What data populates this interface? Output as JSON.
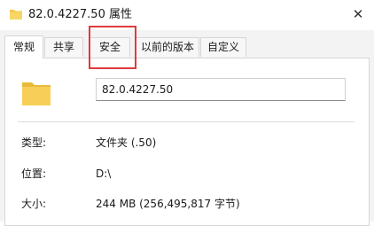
{
  "window": {
    "title": "82.0.4227.50 属性",
    "icon": "folder-icon",
    "close_glyph": "✕"
  },
  "tabs": [
    {
      "label": "常规",
      "active": true
    },
    {
      "label": "共享",
      "active": false
    },
    {
      "label": "安全",
      "active": false,
      "highlighted": true
    },
    {
      "label": "以前的版本",
      "active": false
    },
    {
      "label": "自定义",
      "active": false
    }
  ],
  "general": {
    "folder_icon": "folder-icon",
    "name_value": "82.0.4227.50",
    "properties": [
      {
        "label": "类型:",
        "value": "文件夹 (.50)"
      },
      {
        "label": "位置:",
        "value": "D:\\"
      },
      {
        "label": "大小:",
        "value": "244 MB (256,495,817 字节)"
      }
    ]
  },
  "colors": {
    "highlight_box": "#e03b3b",
    "folder": "#f3c84b"
  }
}
